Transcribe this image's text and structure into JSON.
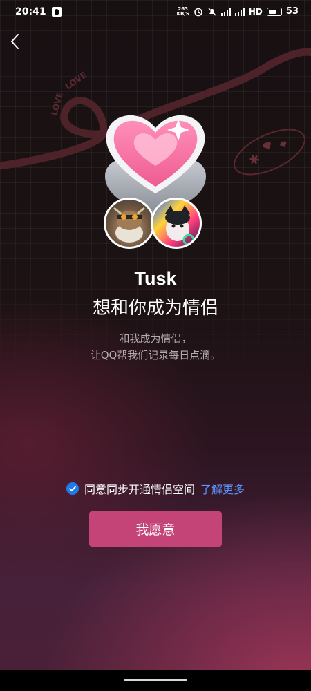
{
  "status_bar": {
    "time": "20:41",
    "net_speed_value": "263",
    "net_speed_unit": "KB/S",
    "hd": "HD",
    "battery": "53",
    "icons": [
      "qq-notification-icon",
      "alarm-icon",
      "mute-icon",
      "signal-icon",
      "signal-icon",
      "battery-icon"
    ]
  },
  "nav": {
    "back_icon": "chevron-left-icon"
  },
  "decor": {
    "love_word": "LOVE"
  },
  "hero": {
    "heart_icon": "heart-icon",
    "avatars": [
      "avatar-left",
      "avatar-right"
    ]
  },
  "main": {
    "name": "Tusk",
    "invite_text": "想和你成为情侣",
    "desc_line1": "和我成为情侣，",
    "desc_line2": "让QQ帮我们记录每日点滴。"
  },
  "agreement": {
    "checked": true,
    "label": "同意同步开通情侣空间",
    "link": "了解更多"
  },
  "action": {
    "accept_label": "我愿意"
  },
  "colors": {
    "accent": "#c44478",
    "link": "#5d94ff",
    "checkbox": "#1f7bea"
  }
}
